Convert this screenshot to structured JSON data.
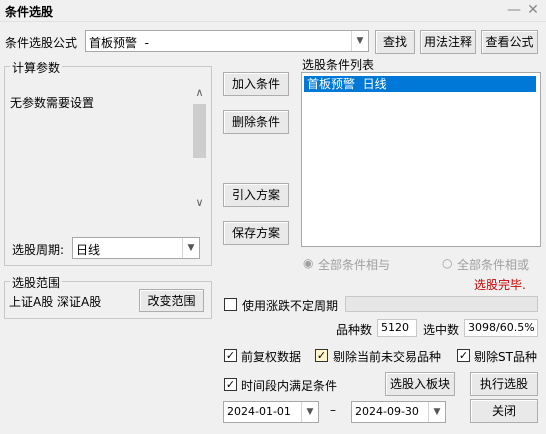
{
  "window": {
    "title": "条件选股"
  },
  "formula": {
    "label": "条件选股公式",
    "value": "首板预警  -",
    "find_button": "查找",
    "usage_button": "用法注释",
    "view_button": "查看公式"
  },
  "params": {
    "group_label": "计算参数",
    "message": "无参数需要设置",
    "period_label": "选股周期:",
    "period_value": "日线"
  },
  "middle_buttons": {
    "add": "加入条件",
    "delete": "删除条件",
    "import": "引入方案",
    "save": "保存方案"
  },
  "conditions": {
    "label": "选股条件列表",
    "items": [
      "首板预警  日线"
    ]
  },
  "logic": {
    "and_label": "全部条件相与",
    "or_label": "全部条件相或",
    "status": "选股完毕."
  },
  "range": {
    "group_label": "选股范围",
    "markets": "上证A股  深证A股",
    "change_button": "改变范围"
  },
  "options": {
    "limit_label": "使用涨跌不定周期",
    "count_label": "品种数",
    "count_value": "5120",
    "selected_label": "选中数",
    "selected_value": "3098/60.5%",
    "pre_adjust": "前复权数据",
    "exclude_untraded": "剔除当前未交易品种",
    "exclude_st": "剔除ST品种",
    "time_range": "时间段内满足条件"
  },
  "actions": {
    "to_block": "选股入板块",
    "execute": "执行选股",
    "close": "关闭"
  },
  "dates": {
    "start": "2024-01-01",
    "dash": "–",
    "end": "2024-09-30"
  },
  "colors": {
    "selection": "#0078d7",
    "status_red": "#cc0000"
  }
}
